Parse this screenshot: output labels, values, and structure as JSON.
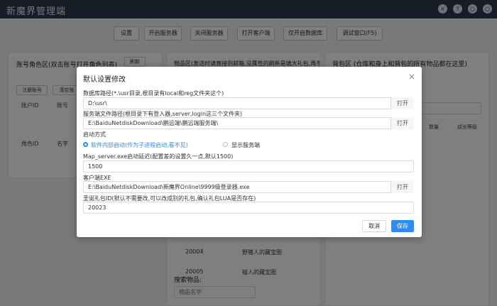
{
  "app": {
    "title": "新魔界管理端"
  },
  "window_controls": [
    "×",
    "?",
    "○",
    "○"
  ],
  "toolbar": {
    "buttons": [
      "设置",
      "开启服务器",
      "关闭服务器",
      "打开客户端",
      "仅开启数据库",
      "调试窗口(F5)"
    ]
  },
  "left_panel": {
    "title": "账号角色区(双击账号打开角色列表)",
    "refresh": "刷新",
    "register": "注册账号",
    "clear": "清空账",
    "account_cols": [
      "账户ID",
      "账号"
    ],
    "role_cols": [
      "角色ID",
      "名字"
    ]
  },
  "middle_panel": {
    "title": "物品区(发送时请直接到邮箱,没属性的刷新是填大礼包,再手动打",
    "rows": [
      {
        "id": "20004",
        "name": "野猪人的藏宝图"
      },
      {
        "id": "20005",
        "name": "蛙人的藏宝图"
      }
    ],
    "search_label": "搜索物品:",
    "search_placeholder": "物品名字"
  },
  "right_panel": {
    "title": "背包区 (仓库和身上和背包的所有物品都在这里)",
    "cols": [
      "数量",
      "成长等级"
    ]
  },
  "modal": {
    "title": "默认设置修改",
    "close": "×",
    "db_path_label": "数据库路径(*.\\usr目录,根目录有local和reg文件夹这个)",
    "db_path_value": "D:\\usr\\",
    "server_path_label": "服务端文件路径(根目录下有登入器,server,login这三个文件夹)",
    "server_path_value": "E:\\BaiduNetdiskDownload\\鹏远端\\鹏远端服务端\\",
    "startup_label": "启动方式",
    "startup_options": [
      "软件内部启动(作为子进程启动,看不见)",
      "显示服务端"
    ],
    "delay_label": "Map_server.exe启动延迟(配置差的设置久一点,默认1500)",
    "delay_value": "1500",
    "client_label": "客户端EXE",
    "client_value": "E:\\BaiduNetdiskDownload\\新魔界Online\\9999级登录器.exe",
    "gift_label": "圣诞礼包ID(默认不需要改,可以改成别的礼包,确认礼包LUA是否存在)",
    "gift_value": "20023",
    "open_label": "打开",
    "cancel": "取消",
    "save": "保存"
  },
  "colors": {
    "titlebar": "#2f3a4e",
    "accent": "#2d8cf0",
    "overlay": "rgba(0,0,0,0.5)"
  }
}
